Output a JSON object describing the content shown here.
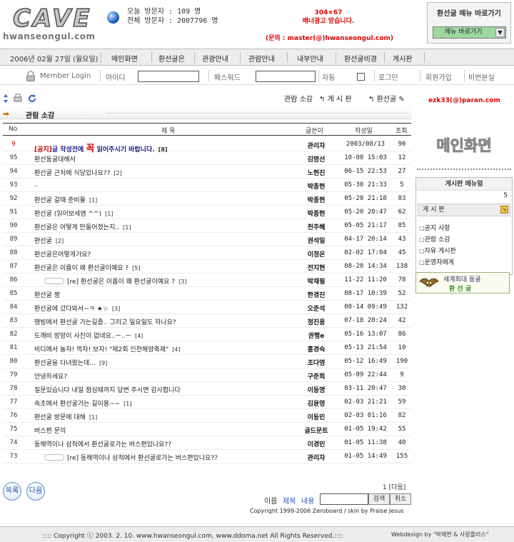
{
  "header": {
    "logo_big": "CAVE",
    "logo_small": "hwanseongul.com",
    "visit_today_label": "오늘 방문자 :",
    "visit_today_value": "109 명",
    "visit_total_label": "전체 방문자 :",
    "visit_total_value": "2007796 명",
    "ad_line1": "304×67",
    "ad_line2": "배너광고 받습니다.",
    "contact": "(문의 : master(@)hwanseongul.com)",
    "quick_title": "환선굴 메뉴 바로가기",
    "quick_select": "메뉴 바로가기"
  },
  "nav": {
    "date": "2006년 02월 27일 (월요일)",
    "items": [
      "메인화면",
      "환선굴은",
      "관광안내",
      "관람안내",
      "내부안내",
      "환선굴비경",
      "게시판"
    ]
  },
  "login": {
    "member_login": "Member Login",
    "id_label": "아이디",
    "pw_label": "패스워드",
    "auto_label": "자동",
    "login_btn": "로그인",
    "join_btn": "회원가입",
    "lost_btn": "비번분실"
  },
  "toolbar": {
    "review": "관람 소감",
    "board": "게 시 판",
    "cave": "환선굴",
    "email": "ezk33(@)paran.com",
    "breadcrumb": "관람 소감"
  },
  "table": {
    "headers": {
      "no": "No",
      "title": "제 목",
      "author": "글쓴이",
      "date": "작성일",
      "hits": "조회"
    },
    "notice": {
      "no": "9",
      "title_a": "[공지]",
      "title_b": "글 작성전에 ",
      "title_big": "꼭",
      "title_c": " 읽어주시기 바랍니다.",
      "cnt": "[8]",
      "author": "관리자",
      "date": "2003/08/13",
      "hits": "90"
    },
    "rows": [
      {
        "no": "95",
        "title": "환선동굴대해서",
        "cnt": "",
        "author": "김영선",
        "date": "10-08 15:03",
        "hits": "12",
        "reply": false
      },
      {
        "no": "94",
        "title": "환선굴 근처에 식당있나요??",
        "cnt": "[2]",
        "author": "노현진",
        "date": "06-15 22:53",
        "hits": "27",
        "reply": false
      },
      {
        "no": "93",
        "title": "..",
        "cnt": "",
        "author": "박종현",
        "date": "05-30 21:33",
        "hits": "5",
        "reply": false
      },
      {
        "no": "92",
        "title": "환선굴 갈때 준비물",
        "cnt": "[1]",
        "author": "박종현",
        "date": "05-20 21:18",
        "hits": "83",
        "reply": false
      },
      {
        "no": "91",
        "title": "환선굴 (읽어보세염 ^^)",
        "cnt": "[1]",
        "author": "박종현",
        "date": "05-20 20:47",
        "hits": "62",
        "reply": false
      },
      {
        "no": "90",
        "title": "환선굴은 어떻게 만들어졌는지..",
        "cnt": "[1]",
        "author": "천주혜",
        "date": "05-05 21:17",
        "hits": "85",
        "reply": false
      },
      {
        "no": "89",
        "title": "환선굴",
        "cnt": "[2]",
        "author": "권석일",
        "date": "04-17 20:14",
        "hits": "43",
        "reply": false
      },
      {
        "no": "88",
        "title": "환선굴은어떻게가요?",
        "cnt": "",
        "author": "이정은",
        "date": "02-02 17:04",
        "hits": "45",
        "reply": false
      },
      {
        "no": "87",
        "title": "환선굴은 이름이 왜 환선굴이예요 ?",
        "cnt": "[5]",
        "author": "전지현",
        "date": "08-20 14:34",
        "hits": "138",
        "reply": false
      },
      {
        "no": "86",
        "title": "[re] 환선굴은 이름이 왜 환선굴이예요 ?",
        "cnt": "[3]",
        "author": "박재필",
        "date": "11-22 11:20",
        "hits": "78",
        "reply": true
      },
      {
        "no": "85",
        "title": "환선굴 짱",
        "cnt": "",
        "author": "한경진",
        "date": "08-17 10:39",
        "hits": "52",
        "reply": false
      },
      {
        "no": "84",
        "title": "환선굴에 갔다와서~ㅋ ★☆",
        "cnt": "[3]",
        "author": "오준석",
        "date": "08-14 09:49",
        "hits": "132",
        "reply": false
      },
      {
        "no": "83",
        "title": "땡빙에서 환선굴 가는길좀.. 그리고 일요일도 하나요?",
        "cnt": "",
        "author": "정진용",
        "date": "07-18 20:24",
        "hits": "42",
        "reply": false
      },
      {
        "no": "82",
        "title": "도깨비 방망이 사진이 없네요..ㅡ..ㅡ",
        "cnt": "[4]",
        "author": "권행e",
        "date": "05-16 13:07",
        "hits": "86",
        "reply": false
      },
      {
        "no": "81",
        "title": "비디에서 놀자! 먹자! 보자! \"제2회 인천해양축제\"",
        "cnt": "[4]",
        "author": "홍경숙",
        "date": "05-13 21:54",
        "hits": "10",
        "reply": false
      },
      {
        "no": "80",
        "title": "환선굴을 다녀왔는데...",
        "cnt": "[9]",
        "author": "조다영",
        "date": "05-12 16:49",
        "hits": "190",
        "reply": false
      },
      {
        "no": "79",
        "title": "안녕하세요?",
        "cnt": "",
        "author": "구준희",
        "date": "05-09 22:44",
        "hits": "9",
        "reply": false
      },
      {
        "no": "78",
        "title": "질문있습니다 내일 점심때까지 답변 주시면 감사합니다",
        "cnt": "",
        "author": "이동명",
        "date": "03-11 20:47",
        "hits": "30",
        "reply": false
      },
      {
        "no": "77",
        "title": "속초에서 환선굴가는 길이용~~",
        "cnt": "[1]",
        "author": "김윤영",
        "date": "02-03 21:21",
        "hits": "59",
        "reply": false
      },
      {
        "no": "76",
        "title": "환선굴 방문에 대해",
        "cnt": "[1]",
        "author": "이동민",
        "date": "02-03 01:16",
        "hits": "82",
        "reply": false
      },
      {
        "no": "75",
        "title": "버스편 문의",
        "cnt": "",
        "author": "골드문트",
        "date": "01-05 19:42",
        "hits": "55",
        "reply": false
      },
      {
        "no": "74",
        "title": "동해역이나 삼척에서 환선굴로가는 버스편있나요??",
        "cnt": "",
        "author": "이경민",
        "date": "01-05 11:38",
        "hits": "40",
        "reply": false
      },
      {
        "no": "73",
        "title": "[re] 동해역이나 삼척에서 환선굴로가는 버스편있나요??",
        "cnt": "",
        "author": "관리자",
        "date": "01-05 14:49",
        "hits": "155",
        "reply": true
      }
    ]
  },
  "pager": "1 [다음]",
  "buttons": {
    "list": "목록",
    "next": "다음"
  },
  "search": {
    "name": "이름",
    "subject": "제목",
    "content": "내용",
    "search_btn": "검색",
    "cancel_btn": "취소"
  },
  "copyright_small": "Copyright 1999-2006 Zeroboard / skin by Praise Jesus",
  "footer": {
    "left": ":::: Copyright ⓒ 2003. 2. 10. www.hwanseongul.com, www.ddoma.net All Rights Reserved.::::",
    "right": "Webdesign by \"박재현 & 사랑플러스\""
  },
  "sidebar": {
    "main_btn": "메인화면",
    "menu_header": "게시판 메뉴얼",
    "menu_num": "5",
    "tab": "게 시 판",
    "items": [
      "공지 사항",
      "관람 소감",
      "자유 게시판",
      "운영자에게"
    ],
    "banner1": "세계최대 동굴",
    "banner2": "환 선 굴"
  }
}
